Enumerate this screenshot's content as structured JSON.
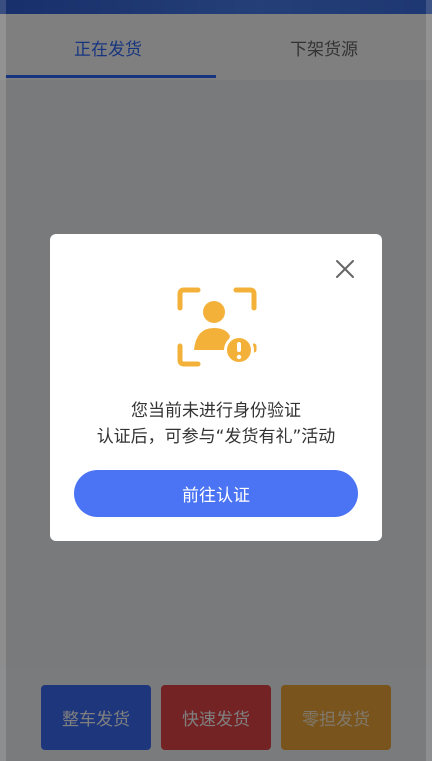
{
  "tabs": [
    {
      "label": "正在发货",
      "active": true
    },
    {
      "label": "下架货源",
      "active": false
    }
  ],
  "actions": [
    {
      "label": "整车发货",
      "color": "#3d6cf7"
    },
    {
      "label": "快速发货",
      "color": "#e8464a"
    },
    {
      "label": "零担发货",
      "color": "#f2a93b"
    }
  ],
  "modal": {
    "line1": "您当前未进行身份验证",
    "line2": "认证后，可参与“发货有礼”活动",
    "button": "前往认证",
    "icon": "identity-warning-icon",
    "close_icon": "close-icon",
    "accent": "#4b74f5",
    "icon_color": "#f3b13a"
  }
}
